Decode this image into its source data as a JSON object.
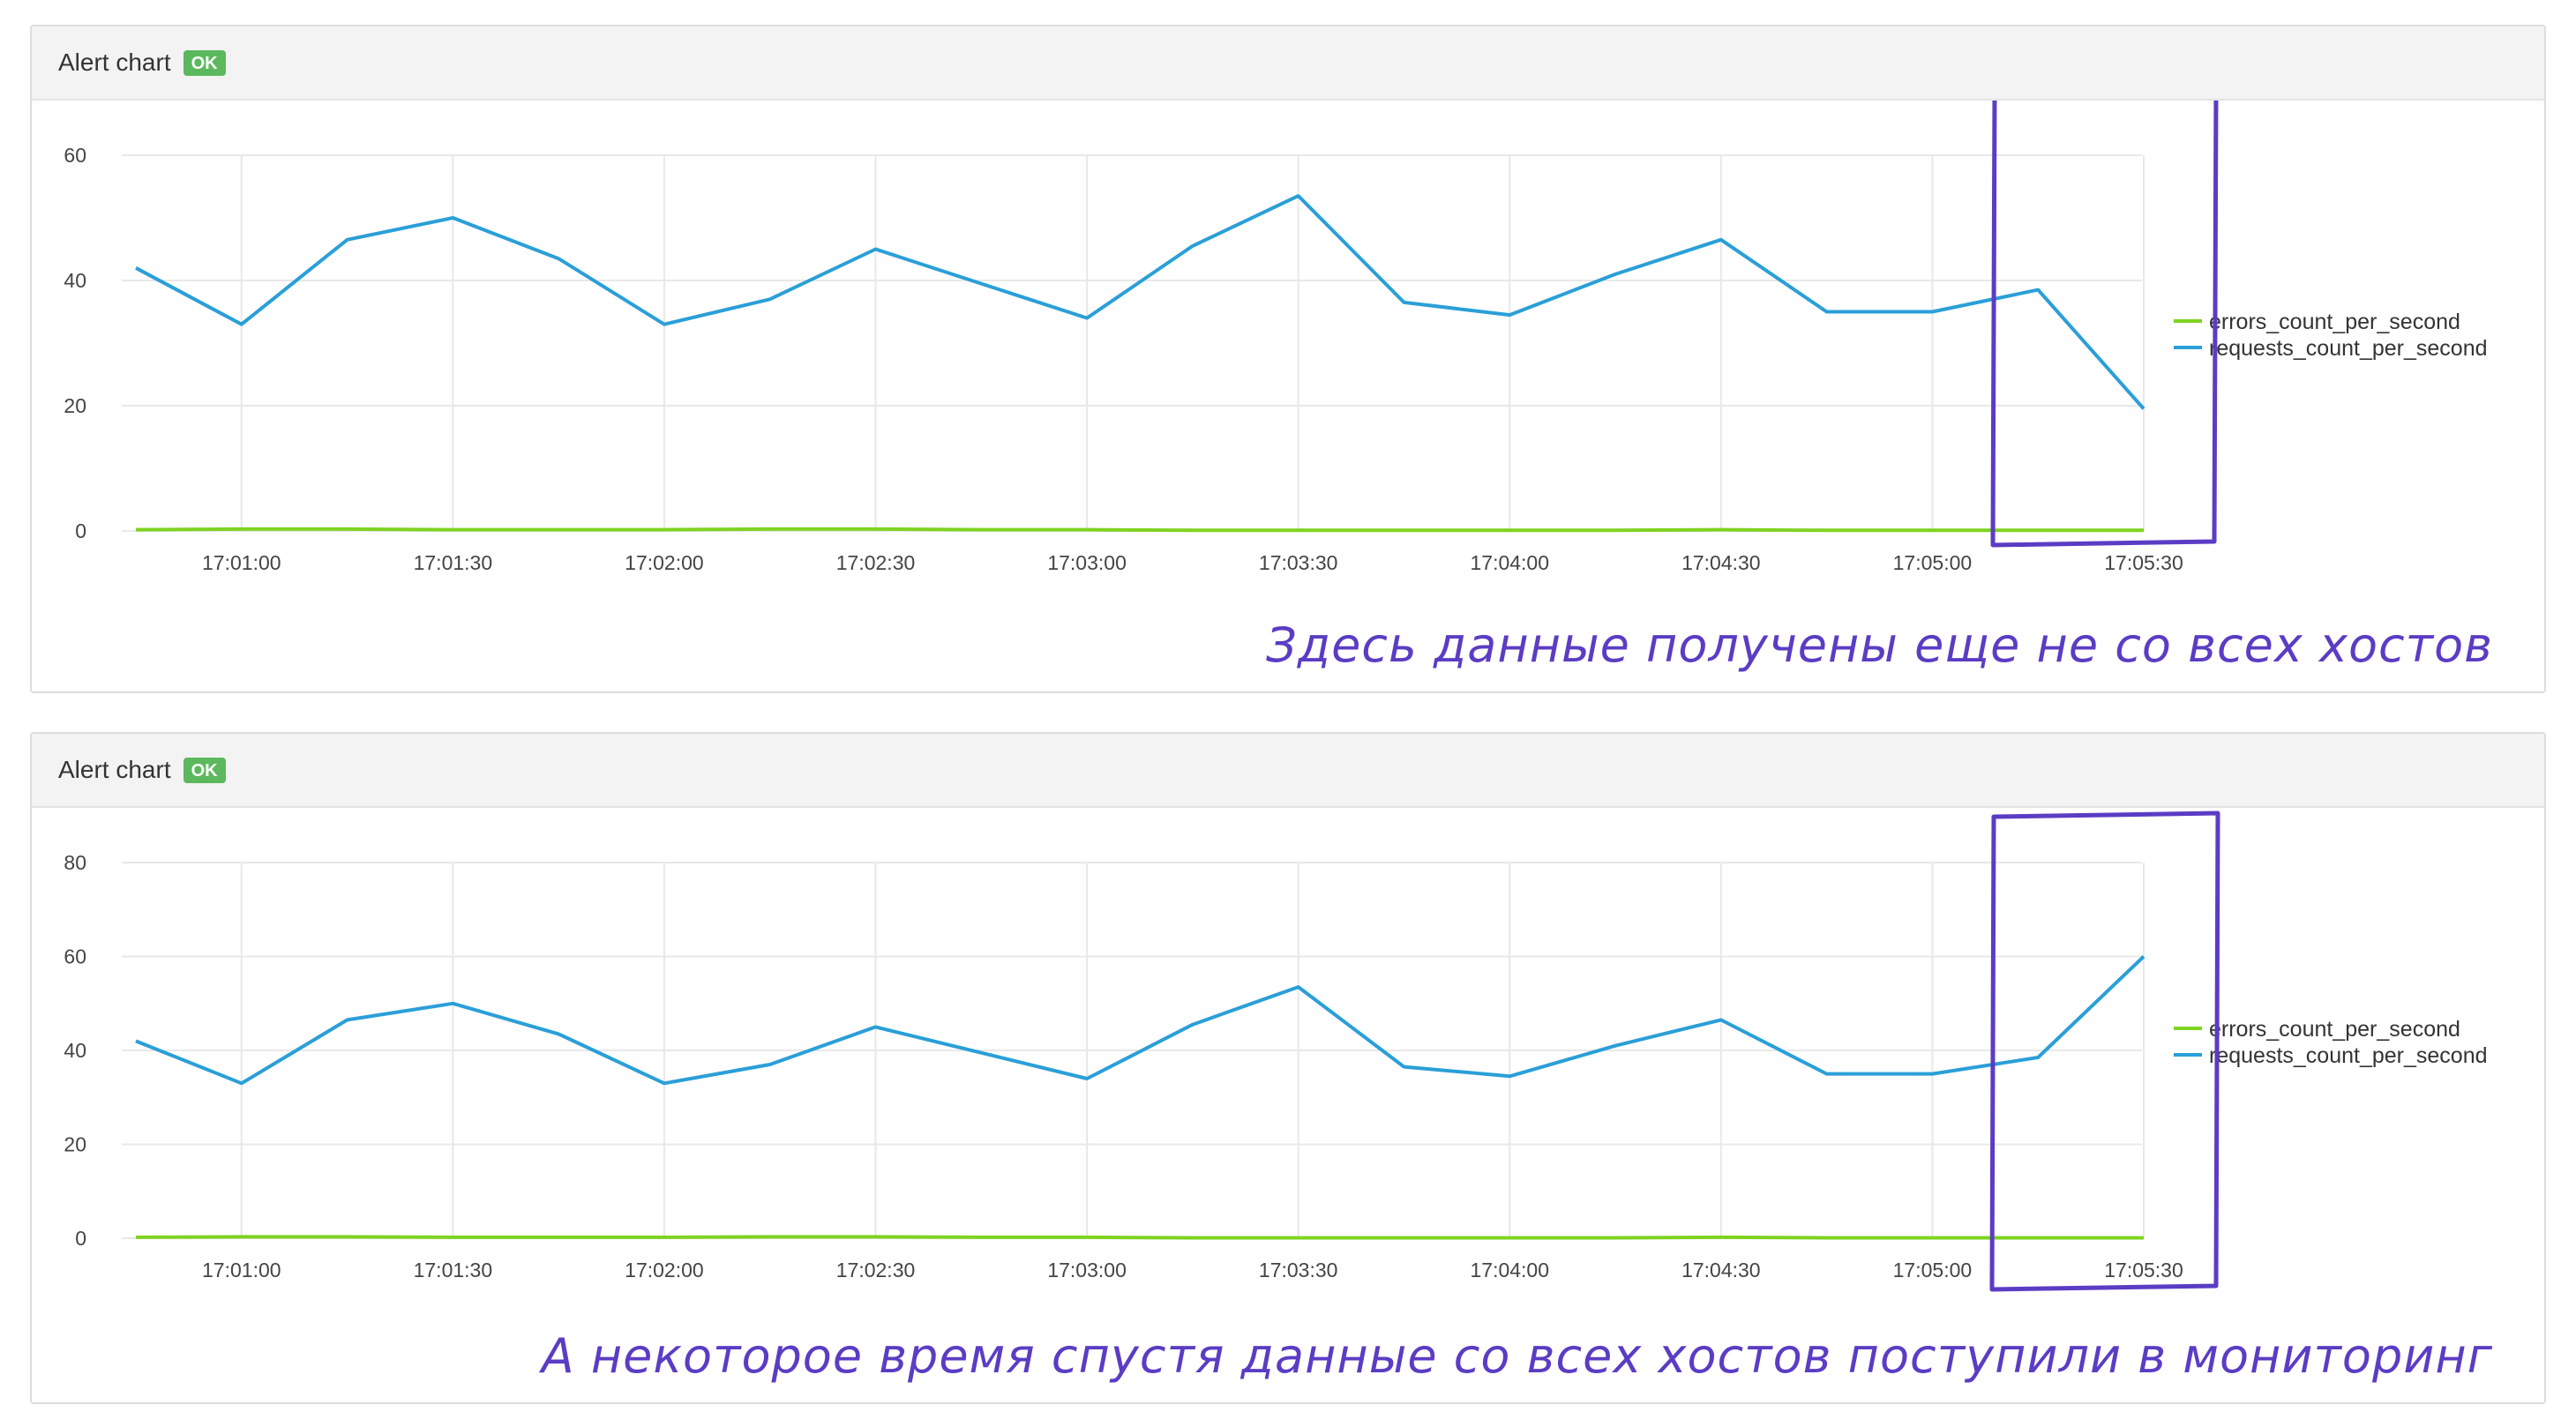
{
  "colors": {
    "errors": "#7ed321",
    "requests": "#2a9fd8",
    "highlight": "#5b3cc4",
    "grid": "#e8e8e8",
    "badge": "#5cb85c"
  },
  "panels": [
    {
      "title": "Alert chart",
      "status": "OK",
      "annotation": "Здесь данные получены еще не со всех хостов"
    },
    {
      "title": "Alert chart",
      "status": "OK",
      "annotation": "А некоторое время спустя данные со всех хостов поступили в мониторинг"
    }
  ],
  "chart_data": [
    {
      "type": "line",
      "x": [
        "17:00:45",
        "17:01:00",
        "17:01:15",
        "17:01:30",
        "17:01:45",
        "17:02:00",
        "17:02:15",
        "17:02:30",
        "17:02:45",
        "17:03:00",
        "17:03:15",
        "17:03:30",
        "17:03:45",
        "17:04:00",
        "17:04:15",
        "17:04:30",
        "17:04:45",
        "17:05:00",
        "17:05:15",
        "17:05:30"
      ],
      "xticks": [
        "17:01:00",
        "17:01:30",
        "17:02:00",
        "17:02:30",
        "17:03:00",
        "17:03:30",
        "17:04:00",
        "17:04:30",
        "17:05:00",
        "17:05:30"
      ],
      "yticks": [
        "0",
        "20",
        "40",
        "60"
      ],
      "ylim": [
        0,
        60
      ],
      "series": [
        {
          "name": "errors_count_per_second",
          "color": "#7ed321",
          "values": [
            0.2,
            0.3,
            0.3,
            0.2,
            0.2,
            0.2,
            0.3,
            0.3,
            0.2,
            0.2,
            0.1,
            0.1,
            0.1,
            0.1,
            0.1,
            0.2,
            0.1,
            0.1,
            0.1,
            0.1
          ]
        },
        {
          "name": "requests_count_per_second",
          "color": "#2a9fd8",
          "values": [
            42,
            33,
            46.5,
            50,
            43.5,
            33,
            37,
            45,
            39.5,
            34,
            45.5,
            53.5,
            36.5,
            34.5,
            41,
            46.5,
            35,
            35,
            38.5,
            19.5
          ]
        }
      ],
      "legend": "right"
    },
    {
      "type": "line",
      "x": [
        "17:00:45",
        "17:01:00",
        "17:01:15",
        "17:01:30",
        "17:01:45",
        "17:02:00",
        "17:02:15",
        "17:02:30",
        "17:02:45",
        "17:03:00",
        "17:03:15",
        "17:03:30",
        "17:03:45",
        "17:04:00",
        "17:04:15",
        "17:04:30",
        "17:04:45",
        "17:05:00",
        "17:05:15",
        "17:05:30"
      ],
      "xticks": [
        "17:01:00",
        "17:01:30",
        "17:02:00",
        "17:02:30",
        "17:03:00",
        "17:03:30",
        "17:04:00",
        "17:04:30",
        "17:05:00",
        "17:05:30"
      ],
      "yticks": [
        "0",
        "20",
        "40",
        "60",
        "80"
      ],
      "ylim": [
        0,
        80
      ],
      "series": [
        {
          "name": "errors_count_per_second",
          "color": "#7ed321",
          "values": [
            0.2,
            0.3,
            0.3,
            0.2,
            0.2,
            0.2,
            0.3,
            0.3,
            0.2,
            0.2,
            0.1,
            0.1,
            0.1,
            0.1,
            0.1,
            0.2,
            0.1,
            0.1,
            0.1,
            0.1
          ]
        },
        {
          "name": "requests_count_per_second",
          "color": "#2a9fd8",
          "values": [
            42,
            33,
            46.5,
            50,
            43.5,
            33,
            37,
            45,
            39.5,
            34,
            45.5,
            53.5,
            36.5,
            34.5,
            41,
            46.5,
            35,
            35,
            38.5,
            60
          ]
        }
      ],
      "legend": "right"
    }
  ]
}
